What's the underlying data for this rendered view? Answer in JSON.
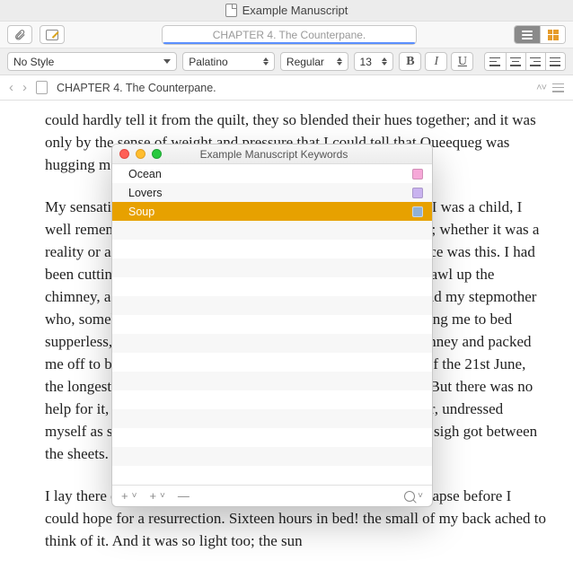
{
  "window": {
    "title": "Example Manuscript"
  },
  "tab": {
    "label": "CHAPTER 4. The Counterpane."
  },
  "style_select": {
    "value": "No Style"
  },
  "font_select": {
    "value": "Palatino"
  },
  "weight_select": {
    "value": "Regular"
  },
  "size_select": {
    "value": "13"
  },
  "biu": {
    "bold": "B",
    "italic": "I",
    "underline": "U"
  },
  "breadcrumb": {
    "title": "CHAPTER 4. The Counterpane."
  },
  "body": {
    "p1": "could hardly tell it from the quilt, they so blended their hues together; and it was only by the sense of weight and pressure that I could tell that Queequeg was hugging me.",
    "p2": "My sensations were strange. Let me try to explain them. When I was a child, I well remember a somewhat similar circumstance that befell me; whether it was a reality or a dream, I never could entirely settle. The circumstance was this. I had been cutting up some caper or other—I think it was trying to crawl up the chimney, as I had seen a little sweep do a few days previous; and my stepmother who, somehow or other, was all the time whipping me, or sending me to bed supperless,—my mother dragged me by the legs out of the chimney and packed me off to bed, though it was only two o'clock in the afternoon of the 21st June, the longest day in the year in our hemisphere. I felt dreadfully. But there was no help for it, so up stairs I went to my little room in the third floor, undressed myself as slowly as possible so as to kill time, and with a bitter sigh got between the sheets.",
    "p3": "I lay there dismally calculating that sixteen entire hours must elapse before I could hope for a resurrection. Sixteen hours in bed! the small of my back ached to think of it. And it was so light too; the sun"
  },
  "keywords_panel": {
    "title": "Example Manuscript Keywords",
    "rows": [
      {
        "label": "Ocean",
        "color": "#f6a8d8",
        "selected": false
      },
      {
        "label": "Lovers",
        "color": "#c9b3ef",
        "selected": false
      },
      {
        "label": "Soup",
        "color": "#8fb0d6",
        "selected": true
      }
    ]
  }
}
